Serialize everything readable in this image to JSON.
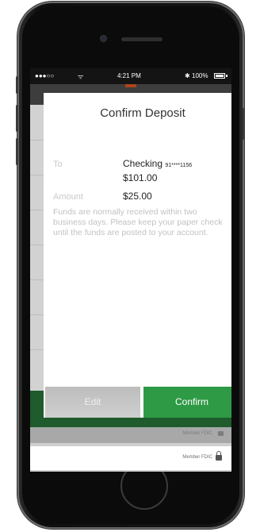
{
  "status_bar": {
    "signal": "●●●○○",
    "wifi": "ᯤ",
    "time": "4:21 PM",
    "bluetooth": "✱",
    "battery": "100%"
  },
  "modal": {
    "title": "Confirm Deposit",
    "to_label": "To",
    "account_name": "Checking",
    "account_number": "91****1156",
    "account_balance": "$101.00",
    "amount_label": "Amount",
    "amount_value": "$25.00",
    "notice": "Funds are normally received within two business days. Please keep your paper check until the funds are posted to your account.",
    "edit_button": "Edit",
    "confirm_button": "Confirm"
  },
  "footer": {
    "member_fdic_dimmed": "Member FDIC",
    "member_fdic": "Member FDIC"
  },
  "colors": {
    "confirm_green": "#2e9a45",
    "edit_gray": "#c6c6c6",
    "status_bar": "#141414"
  }
}
